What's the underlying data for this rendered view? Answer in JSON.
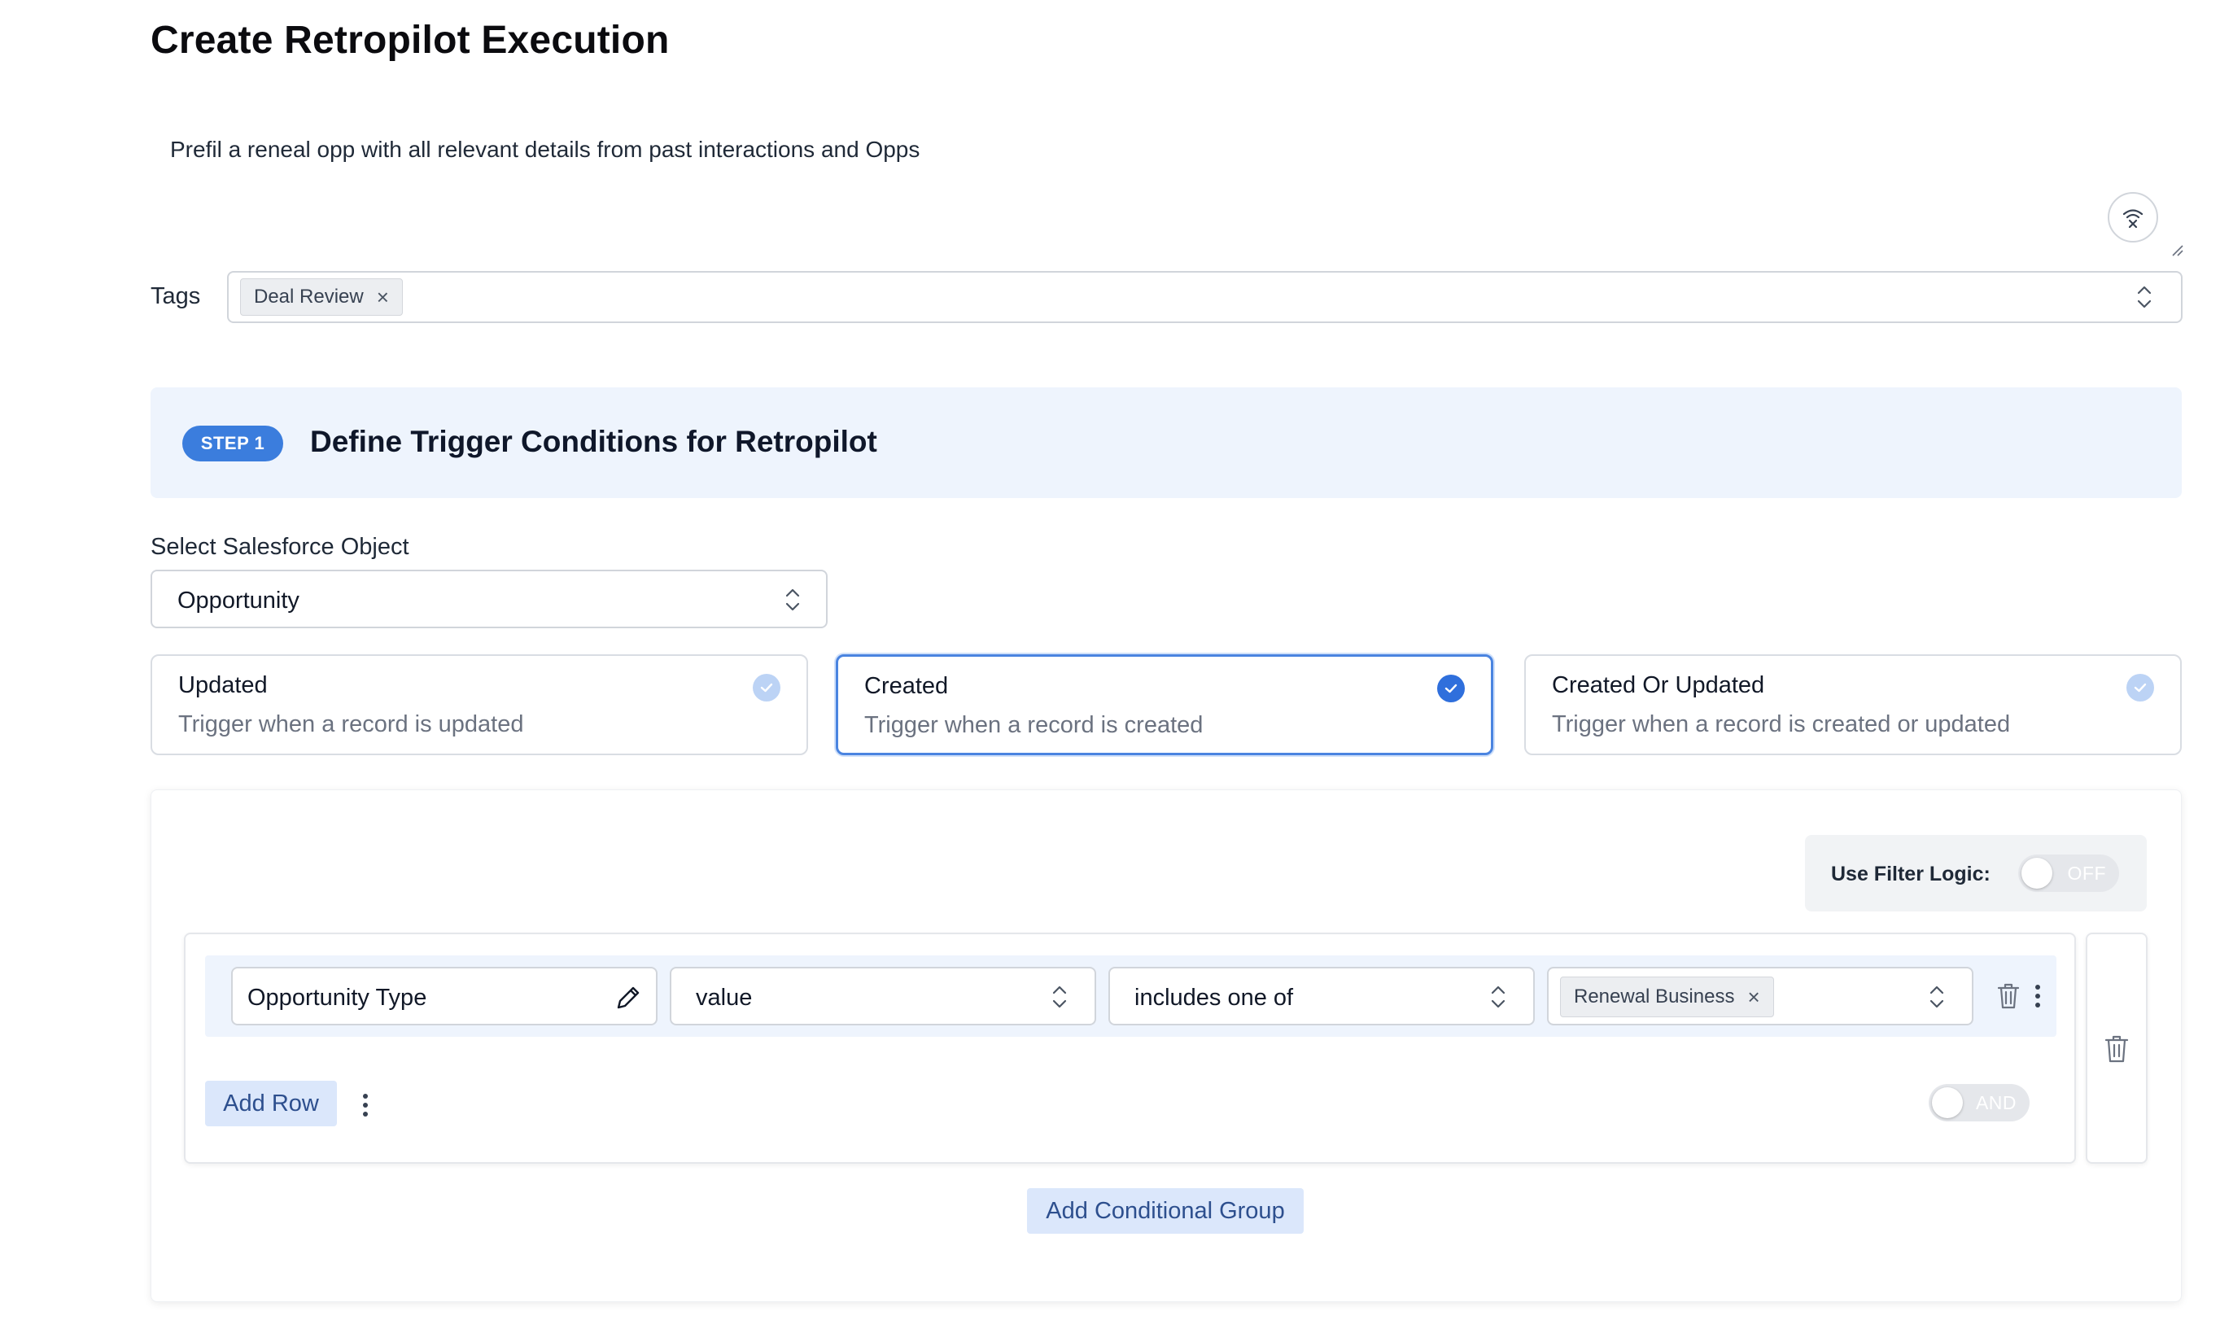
{
  "page": {
    "title": "Create Retropilot Execution",
    "description": "Prefil a reneal opp with all relevant details from past interactions and Opps"
  },
  "tags": {
    "label": "Tags",
    "chips": [
      "Deal Review"
    ]
  },
  "step": {
    "badge": "STEP 1",
    "title": "Define Trigger Conditions for Retropilot"
  },
  "salesforce_object": {
    "label": "Select Salesforce Object",
    "value": "Opportunity"
  },
  "triggers": [
    {
      "title": "Updated",
      "subtitle": "Trigger when a record is updated",
      "selected": false
    },
    {
      "title": "Created",
      "subtitle": "Trigger when a record is created",
      "selected": true
    },
    {
      "title": "Created Or Updated",
      "subtitle": "Trigger when a record is created or updated",
      "selected": false
    }
  ],
  "filter_logic": {
    "label": "Use Filter Logic:",
    "state": "OFF"
  },
  "condition_row": {
    "field": "Opportunity Type",
    "source": "value",
    "operator": "includes one of",
    "values": [
      "Renewal Business"
    ]
  },
  "group": {
    "add_row_label": "Add Row",
    "join_operator": "AND"
  },
  "add_group_label": "Add Conditional Group",
  "colors": {
    "accent": "#3b7ddd",
    "panel_bg": "#eef4fd",
    "button_bg": "#dbe7fb",
    "button_text": "#2d4f8e"
  }
}
